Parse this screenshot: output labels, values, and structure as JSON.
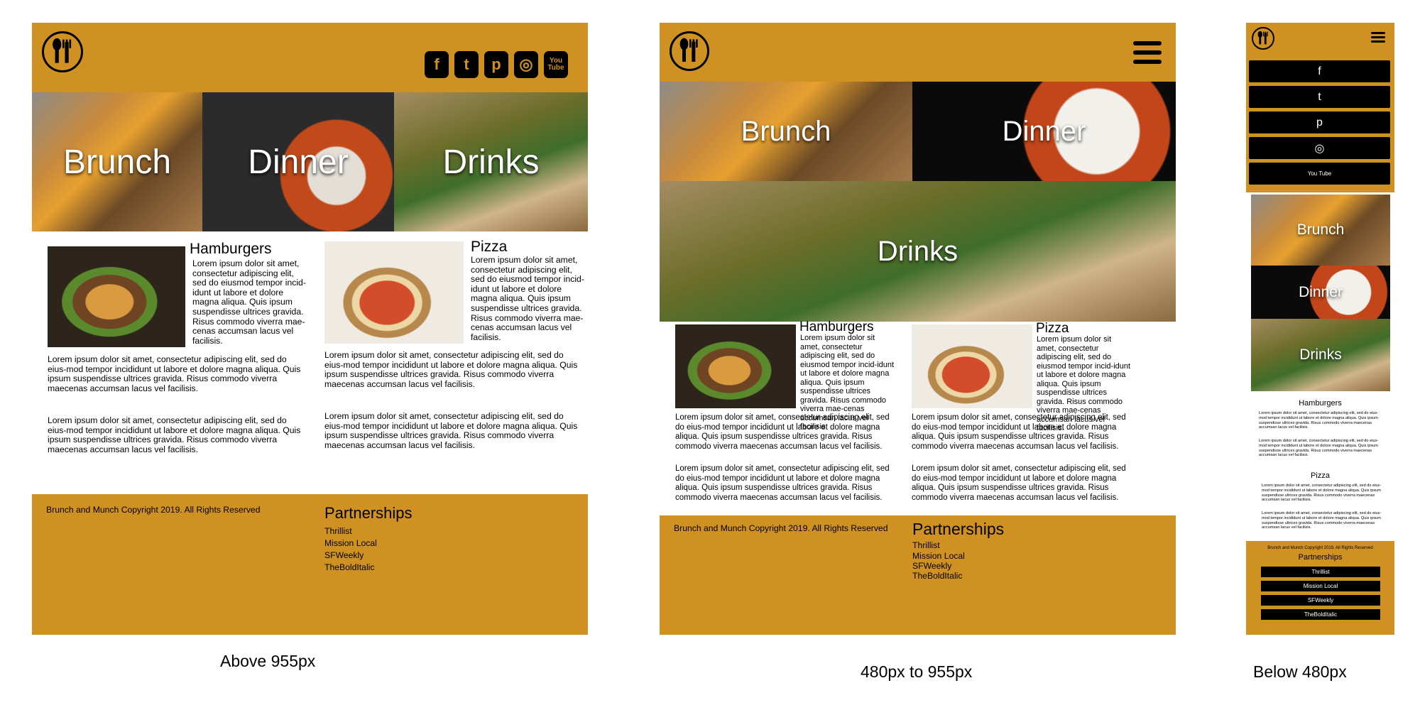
{
  "site": "Brunch and Munch",
  "categories": [
    "Brunch",
    "Dinner",
    "Drinks"
  ],
  "icons": {
    "logo": "fork-spoon-logo-icon",
    "social": [
      "facebook-icon",
      "twitter-icon",
      "pinterest-icon",
      "instagram-icon",
      "youtube-icon"
    ],
    "menu": "hamburger-menu-icon"
  },
  "social_glyphs": {
    "facebook": "f",
    "twitter": "t",
    "pinterest": "p",
    "instagram": "◎",
    "youtube": "You Tube"
  },
  "articles": [
    {
      "title": "Hamburgers",
      "intro": "Lorem ipsum dolor sit amet, consectetur adipiscing elit, sed do eiusmod tempor incid-idunt ut labore et dolore magna aliqua. Quis ipsum suspendisse ultrices gravida. Risus commodo viverra mae-cenas accumsan lacus vel facilisis.",
      "para1": "Lorem ipsum dolor sit amet, consectetur adipiscing elit, sed do eius-mod tempor incididunt ut labore et dolore magna aliqua. Quis ipsum suspendisse ultrices gravida. Risus commodo viverra maecenas accumsan lacus vel facilisis.",
      "para2": "Lorem ipsum dolor sit amet, consectetur adipiscing elit, sed do eius-mod tempor incididunt ut labore et dolore magna aliqua. Quis ipsum suspendisse ultrices gravida. Risus commodo viverra maecenas accumsan lacus vel facilisis."
    },
    {
      "title": "Pizza",
      "intro": "Lorem ipsum dolor sit amet, consectetur adipiscing elit, sed do eiusmod tempor incid-idunt ut labore et dolore magna aliqua. Quis ipsum suspendisse ultrices gravida. Risus commodo viverra mae-cenas accumsan lacus vel facilisis.",
      "para1": "Lorem ipsum dolor sit amet, consectetur adipiscing elit, sed do eius-mod tempor incididunt ut labore et dolore magna aliqua. Quis ipsum suspendisse ultrices gravida. Risus commodo viverra maecenas accumsan lacus vel facilisis.",
      "para2": "Lorem ipsum dolor sit amet, consectetur adipiscing elit, sed do eius-mod tempor incididunt ut labore et dolore magna aliqua. Quis ipsum suspendisse ultrices gravida. Risus commodo viverra maecenas accumsan lacus vel facilisis."
    }
  ],
  "footer": {
    "copyright": "Brunch and Munch Copyright 2019. All Rights Reserved",
    "partnerships_title": "Partnerships",
    "partners": [
      "Thrillist",
      "Mission Local",
      "SFWeekly",
      "TheBoldItalic"
    ]
  },
  "captions": {
    "large": "Above 955px",
    "medium": "480px to 955px",
    "small": "Below 480px"
  },
  "colors": {
    "brand": "#cf9121",
    "text": "#000000",
    "background": "#ffffff"
  }
}
